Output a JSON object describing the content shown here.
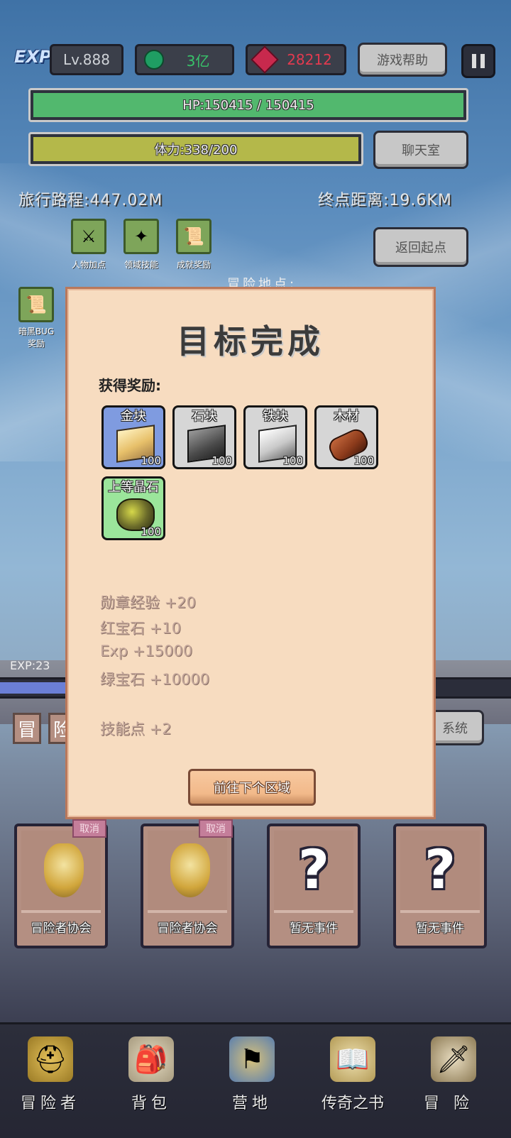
{
  "header": {
    "exp_badge": "EXP",
    "level": "Lv.888",
    "green_gems": "3亿",
    "red_gems": "28212",
    "help_button": "游戏帮助",
    "pause_icon": "pause-icon"
  },
  "bars": {
    "hp_text": "HP:150415 / 150415",
    "hp_fraction": 1.0,
    "stamina_text": "体力:338/200",
    "stamina_fraction": 1.0,
    "chat_button": "聊天室"
  },
  "travel": {
    "traveled": "旅行路程:447.02M",
    "remaining": "终点距离:19.6KM",
    "return_button": "返回起点",
    "adventure_location": "冒险地点:"
  },
  "quick_icons": [
    {
      "label": "人物加点",
      "icon": "crossed-swords-icon"
    },
    {
      "label": "领域技能",
      "icon": "skill-icon"
    },
    {
      "label": "成就奖励",
      "icon": "scroll-icon"
    }
  ],
  "bug_reward": {
    "label_line1": "暗黑BUG",
    "label_line2": "奖励",
    "icon": "scroll-icon"
  },
  "background_text": {
    "exp_label": "EXP:23",
    "adventure_tab_1": "冒",
    "adventure_tab_2": "险",
    "system_button": "系统"
  },
  "dialog": {
    "title": "目标完成",
    "rewards_label": "获得奖励:",
    "items": [
      {
        "name": "金块",
        "qty": "100",
        "color": "#7f9be0"
      },
      {
        "name": "石块",
        "qty": "100",
        "color": "#d7d7d7"
      },
      {
        "name": "铁块",
        "qty": "100",
        "color": "#d7d7d7"
      },
      {
        "name": "木材",
        "qty": "100",
        "color": "#d7d7d7"
      },
      {
        "name": "上等晶石",
        "qty": "100",
        "color": "#9be59b"
      }
    ],
    "stats": [
      "勋章经验 +20",
      "红宝石 +10",
      "Exp +15000",
      "绿宝石 +10000"
    ],
    "skill_points": "技能点 +2",
    "next_button": "前往下个区域"
  },
  "event_cards": [
    {
      "caption": "冒险者协会",
      "cancel": "取消",
      "icon": "guild-emblem-icon"
    },
    {
      "caption": "冒险者协会",
      "cancel": "取消",
      "icon": "guild-emblem-icon"
    },
    {
      "caption": "暂无事件",
      "cancel": "",
      "icon": "question-mark-icon"
    },
    {
      "caption": "暂无事件",
      "cancel": "",
      "icon": "question-mark-icon"
    }
  ],
  "navbar": [
    {
      "label": "冒险者",
      "icon": "helmet-icon"
    },
    {
      "label": "背包",
      "icon": "backpack-icon"
    },
    {
      "label": "营地",
      "icon": "banner-icon"
    },
    {
      "label": "传奇之书",
      "icon": "book-icon"
    },
    {
      "label": "冒险",
      "icon": "sword-icon"
    }
  ]
}
